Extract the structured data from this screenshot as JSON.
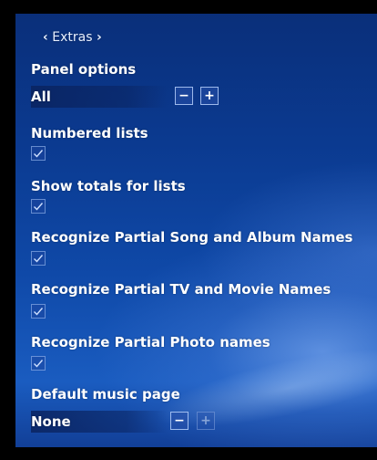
{
  "header": {
    "prev_icon": "chevron-left-icon",
    "title": "Extras",
    "next_icon": "chevron-right-icon"
  },
  "settings": [
    {
      "label": "Panel options",
      "type": "spinner",
      "value": "All"
    },
    {
      "label": "Numbered lists",
      "type": "checkbox",
      "checked": true
    },
    {
      "label": "Show totals for lists",
      "type": "checkbox",
      "checked": true
    },
    {
      "label": "Recognize Partial Song and Album Names",
      "type": "checkbox",
      "checked": true
    },
    {
      "label": "Recognize Partial TV and Movie Names",
      "type": "checkbox",
      "checked": true
    },
    {
      "label": "Recognize Partial Photo names",
      "type": "checkbox",
      "checked": true
    },
    {
      "label": "Default music page",
      "type": "spinner",
      "value": "None"
    }
  ],
  "buttons": {
    "minus": "−",
    "plus": "+"
  },
  "colors": {
    "background_top": "#0a2f7a",
    "background_bottom": "#1a5cc0",
    "text": "#ffffff"
  }
}
